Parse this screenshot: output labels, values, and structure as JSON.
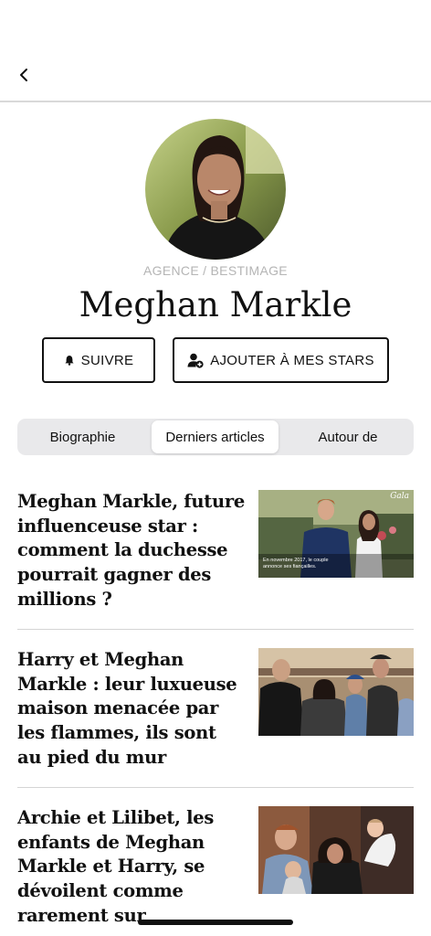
{
  "profile": {
    "photo_credit": "AGENCE / BESTIMAGE",
    "name": "Meghan Markle"
  },
  "actions": {
    "follow_label": "SUIVRE",
    "add_label": "AJOUTER À MES STARS"
  },
  "tabs": [
    {
      "label": "Biographie",
      "active": false
    },
    {
      "label": "Derniers articles",
      "active": true
    },
    {
      "label": "Autour de",
      "active": false
    }
  ],
  "articles": [
    {
      "title": "Meghan Markle, future influenceuse star : comment la duchesse pourrait gagner des millions ?",
      "thumb_caption": "En novembre 2017, le couple annonce ses fiançailles.",
      "thumb_brand": "Gala"
    },
    {
      "title": "Harry et Meghan Markle : leur luxueuse maison menacée par les flammes, ils sont au pied du mur"
    },
    {
      "title": "Archie et Lilibet, les enfants de Meghan Markle et Harry, se dévoilent comme rarement sur Instagram"
    }
  ],
  "icons": {
    "back": "chevron-left-icon",
    "follow": "bell-icon",
    "add": "user-plus-icon"
  }
}
